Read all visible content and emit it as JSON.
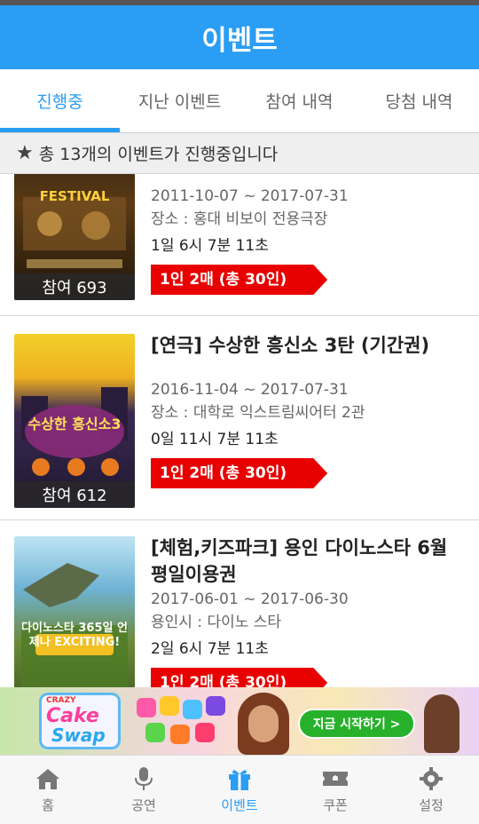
{
  "header": {
    "title": "이벤트"
  },
  "tabs": [
    {
      "label": "진행중"
    },
    {
      "label": "지난 이벤트"
    },
    {
      "label": "참여 내역"
    },
    {
      "label": "당첨 내역"
    }
  ],
  "banner": {
    "text": "총 13개의 이벤트가 진행중입니다"
  },
  "events": [
    {
      "title": "",
      "date": "2011-10-07 ~ 2017-07-31",
      "place": "장소 : 홍대 비보이 전용극장",
      "remain": "1일 6시 7분 11초",
      "participants": "참여 693",
      "ribbon": "1인 2매 (총 30인)",
      "poster_text": "FESTIVAL"
    },
    {
      "title": "[연극] 수상한 흥신소 3탄 (기간권)",
      "date": "2016-11-04 ~ 2017-07-31",
      "place": "장소 : 대학로 익스트림씨어터 2관",
      "remain": "0일 11시 7분 11초",
      "participants": "참여 612",
      "ribbon": "1인 2매 (총 30인)",
      "poster_text": "수상한 흥신소3"
    },
    {
      "title": "[체험,키즈파크] 용인 다이노스타 6월 평일이용권",
      "date": "2017-06-01 ~ 2017-06-30",
      "place": "용인시 : 다이노 스타",
      "remain": "2일 6시 7분 11초",
      "participants": "",
      "ribbon": "1인 2매 (총 30인)",
      "poster_text": "다이노스타 365일 언제나 EXCITING!"
    }
  ],
  "ad": {
    "logo_top": "CRAZY",
    "logo_line1": "Cake",
    "logo_line2": "Swap",
    "cta": "지금 시작하기 >"
  },
  "bottom_nav": [
    {
      "label": "홈",
      "icon": "home-icon"
    },
    {
      "label": "공연",
      "icon": "microphone-icon"
    },
    {
      "label": "이벤트",
      "icon": "gift-icon"
    },
    {
      "label": "쿠폰",
      "icon": "ticket-icon"
    },
    {
      "label": "설정",
      "icon": "gear-icon"
    }
  ],
  "colors": {
    "accent": "#2a9df4",
    "ribbon": "#e80000"
  }
}
